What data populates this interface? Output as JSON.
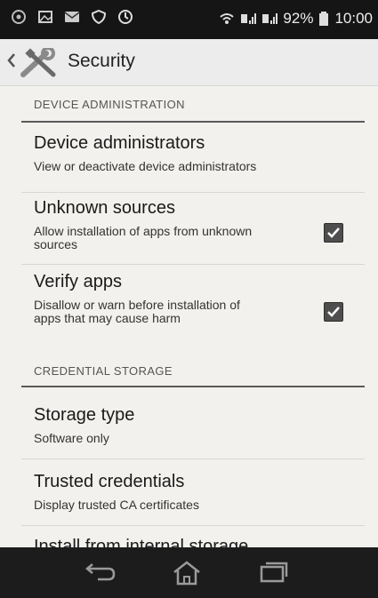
{
  "status_bar": {
    "battery_percent": "92%",
    "time": "10:00",
    "icons": [
      "app-notification-icon",
      "gallery-notification-icon",
      "email-notification-icon",
      "shield-notification-icon",
      "sync-notification-icon",
      "wifi-icon",
      "sim1-signal-icon",
      "sim2-signal-icon",
      "battery-icon"
    ]
  },
  "action_bar": {
    "title": "Security",
    "icon": "tools-icon"
  },
  "sections": {
    "device_administration": {
      "header": "DEVICE ADMINISTRATION"
    },
    "credential_storage": {
      "header": "CREDENTIAL STORAGE"
    }
  },
  "prefs": {
    "device_admins": {
      "title": "Device administrators",
      "summary": "View or deactivate device administrators"
    },
    "unknown_sources": {
      "title": "Unknown sources",
      "summary": "Allow installation of apps from unknown sources",
      "checked": true
    },
    "verify_apps": {
      "title": "Verify apps",
      "summary": "Disallow or warn before installation of apps that may cause harm",
      "checked": true
    },
    "storage_type": {
      "title": "Storage type",
      "summary": "Software only"
    },
    "trusted_credentials": {
      "title": "Trusted credentials",
      "summary": "Display trusted CA certificates"
    },
    "install_storage": {
      "title": "Install from internal storage"
    }
  },
  "nav_bar": {
    "buttons": [
      "back-icon",
      "home-icon",
      "recent-apps-icon"
    ]
  },
  "colors": {
    "status_bar_bg": "#151515",
    "action_bar_bg": "#ececec",
    "content_bg": "#f3f1ee",
    "checkbox_fill": "#4e4e4e",
    "nav_bar_bg": "#1c1c1c"
  }
}
